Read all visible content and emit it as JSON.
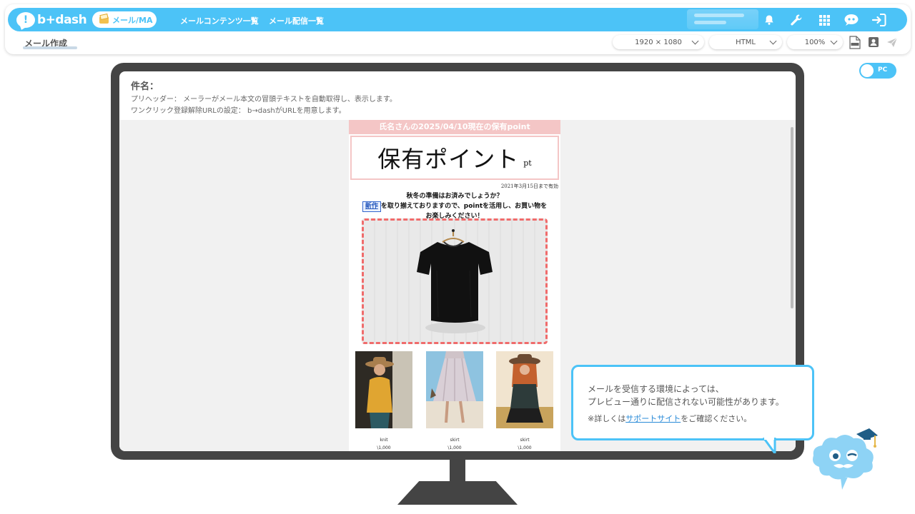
{
  "header": {
    "logo_text": "b+dash",
    "module_label": "メール/MA",
    "nav": [
      "メールコンテンツ一覧",
      "メール配信一覧"
    ],
    "page_title": "メール作成"
  },
  "toolbar": {
    "resolution": "1920 × 1080",
    "format": "HTML",
    "zoom": "100%"
  },
  "toggle": {
    "label": "PC"
  },
  "mail": {
    "subject_label": "件名：",
    "preheader": "プリヘッダー： メーラーがメール本文の冒頭テキストを自動取得し、表示します。",
    "unsubscribe": "ワンクリック登録解除URLの設定： b→dashがURLを用意します。"
  },
  "email": {
    "header": "氏名さんの2025/04/10現在の保有point",
    "point_label": "保有ポイント",
    "point_unit": "pt",
    "valid_until": "2021年3月15日まで有効",
    "line1": "秋冬の準備はお済みでしょうか？",
    "badge": "新作",
    "line2": "を取り揃えておりますので、pointを活用し、お買い物を",
    "line3": "お楽しみください！",
    "products": [
      {
        "name": "knit",
        "price": "\\1,000"
      },
      {
        "name": "skirt",
        "price": "\\1,000"
      },
      {
        "name": "skirt",
        "price": "\\1,000"
      }
    ]
  },
  "notice": {
    "line1": "メールを受信する環境によっては、",
    "line2": "プレビュー通りに配信されない可能性があります。",
    "note_prefix": "※詳しくは",
    "link": "サポートサイト",
    "note_suffix": "をご確認ください。"
  },
  "colors": {
    "accent": "#4cc3f7",
    "monitor": "#444444",
    "email_pink": "#f4c6c6",
    "dashed_border": "#f06b6b"
  },
  "icons": {
    "top": [
      "bell-icon",
      "wrench-icon",
      "grid-icon",
      "support-bubble-icon",
      "logout-icon"
    ],
    "tools": [
      "html-file-icon",
      "contact-card-icon",
      "send-icon"
    ]
  }
}
